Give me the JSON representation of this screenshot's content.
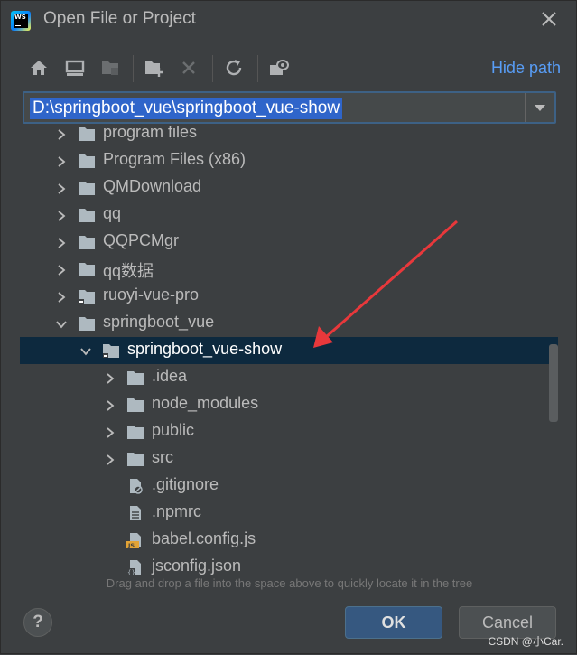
{
  "window": {
    "title": "Open File or Project",
    "app_icon": "webstorm-logo",
    "app_logo_text": "WS"
  },
  "toolbar": {
    "icons": [
      "home-icon",
      "desktop-icon",
      "project-folder-icon",
      "new-folder-icon",
      "delete-icon",
      "refresh-icon",
      "show-hidden-icon"
    ],
    "hide_path_label": "Hide path"
  },
  "path": {
    "value": "D:\\springboot_vue\\springboot_vue-show"
  },
  "tree": {
    "items": [
      {
        "label": "program files",
        "level": 0,
        "expanded": false,
        "icon": "folder-icon"
      },
      {
        "label": "Program Files (x86)",
        "level": 0,
        "expanded": false,
        "icon": "folder-icon"
      },
      {
        "label": "QMDownload",
        "level": 0,
        "expanded": false,
        "icon": "folder-icon"
      },
      {
        "label": "qq",
        "level": 0,
        "expanded": false,
        "icon": "folder-icon"
      },
      {
        "label": "QQPCMgr",
        "level": 0,
        "expanded": false,
        "icon": "folder-icon"
      },
      {
        "label": "qq数据",
        "level": 0,
        "expanded": false,
        "icon": "folder-icon"
      },
      {
        "label": "ruoyi-vue-pro",
        "level": 0,
        "expanded": false,
        "icon": "project-folder-icon"
      },
      {
        "label": "springboot_vue",
        "level": 0,
        "expanded": true,
        "icon": "folder-icon"
      },
      {
        "label": "springboot_vue-show",
        "level": 1,
        "expanded": true,
        "icon": "project-folder-icon",
        "selected": true
      },
      {
        "label": ".idea",
        "level": 2,
        "expanded": false,
        "icon": "folder-icon"
      },
      {
        "label": "node_modules",
        "level": 2,
        "expanded": false,
        "icon": "folder-icon"
      },
      {
        "label": "public",
        "level": 2,
        "expanded": false,
        "icon": "folder-icon"
      },
      {
        "label": "src",
        "level": 2,
        "expanded": false,
        "icon": "folder-icon"
      },
      {
        "label": ".gitignore",
        "level": 2,
        "icon": "gitignore-file-icon"
      },
      {
        "label": ".npmrc",
        "level": 2,
        "icon": "text-file-icon"
      },
      {
        "label": "babel.config.js",
        "level": 2,
        "icon": "js-file-icon"
      },
      {
        "label": "jsconfig.json",
        "level": 2,
        "icon": "json-file-icon"
      }
    ]
  },
  "drop_hint": "Drag and drop a file into the space above to quickly locate it in the tree",
  "buttons": {
    "help_label": "?",
    "ok_label": "OK",
    "cancel_label": "Cancel"
  },
  "watermark": "CSDN @小Car.",
  "colors": {
    "background": "#3c3f41",
    "selection": "#0d293e",
    "path_highlight": "#2f65ca",
    "link": "#589df6",
    "primary_button": "#365880",
    "annotation_arrow": "#e8383b",
    "folder": "#aeb9c0"
  }
}
